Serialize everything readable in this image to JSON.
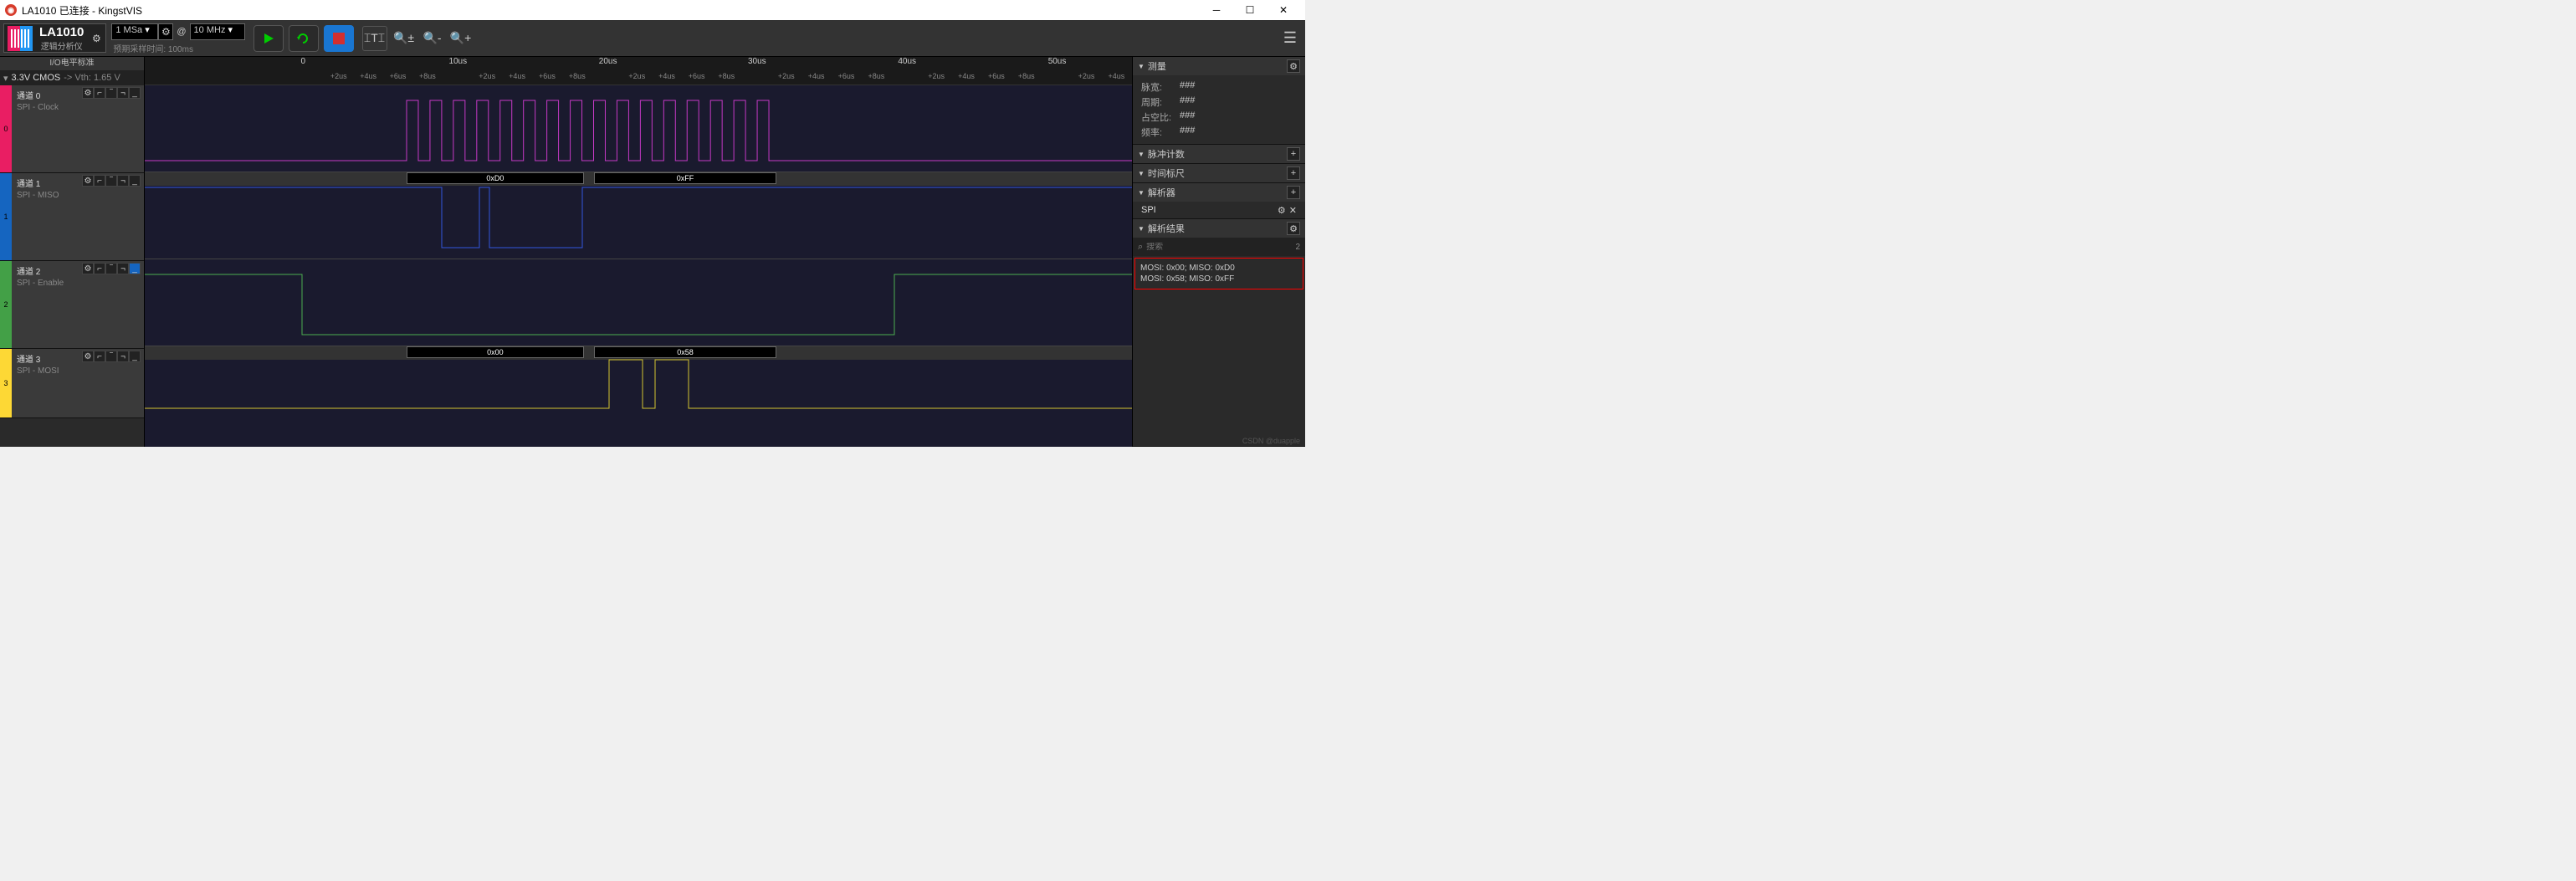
{
  "window": {
    "title": "LA1010 已连接 - KingstVIS"
  },
  "device": {
    "name": "LA1010",
    "subtitle": "逻辑分析仪"
  },
  "sampling": {
    "depth": "1 MSa",
    "at": "@",
    "rate": "10 MHz",
    "hint": "预期采样时间: 100ms"
  },
  "io_standard_label": "I/O电平标准",
  "voltage": {
    "mode": "3.3V CMOS",
    "vth": "-> Vth: 1.65 V"
  },
  "ruler": {
    "majors": [
      {
        "x": 0.158,
        "label": "0"
      },
      {
        "x": 0.308,
        "label": "10us"
      },
      {
        "x": 0.46,
        "label": "20us"
      },
      {
        "x": 0.611,
        "label": "30us"
      },
      {
        "x": 0.763,
        "label": "40us"
      },
      {
        "x": 0.915,
        "label": "50us"
      }
    ],
    "minors": [
      "+2us",
      "+4us",
      "+6us",
      "+8us"
    ]
  },
  "channels": [
    {
      "idx": "0",
      "name": "通道 0",
      "sub": "SPI - Clock"
    },
    {
      "idx": "1",
      "name": "通道 1",
      "sub": "SPI - MISO"
    },
    {
      "idx": "2",
      "name": "通道 2",
      "sub": "SPI - Enable"
    },
    {
      "idx": "3",
      "name": "通道 3",
      "sub": "SPI - MOSI"
    }
  ],
  "decode": {
    "miso": [
      "0xD0",
      "0xFF"
    ],
    "mosi": [
      "0x00",
      "0x58"
    ]
  },
  "sidebar": {
    "measure": {
      "title": "测量",
      "rows": [
        {
          "l": "脉宽:",
          "v": "###"
        },
        {
          "l": "周期:",
          "v": "###"
        },
        {
          "l": "占空比:",
          "v": "###"
        },
        {
          "l": "频率:",
          "v": "###"
        }
      ]
    },
    "pulse": {
      "title": "脉冲计数"
    },
    "marker": {
      "title": "时间标尺"
    },
    "analyzer": {
      "title": "解析器",
      "item": "SPI"
    },
    "results": {
      "title": "解析结果",
      "search_placeholder": "搜索",
      "count": "2",
      "rows": [
        "MOSI: 0x00;   MISO: 0xD0",
        "MOSI: 0x58;   MISO: 0xFF"
      ]
    }
  },
  "watermark": "CSDN @duapple"
}
